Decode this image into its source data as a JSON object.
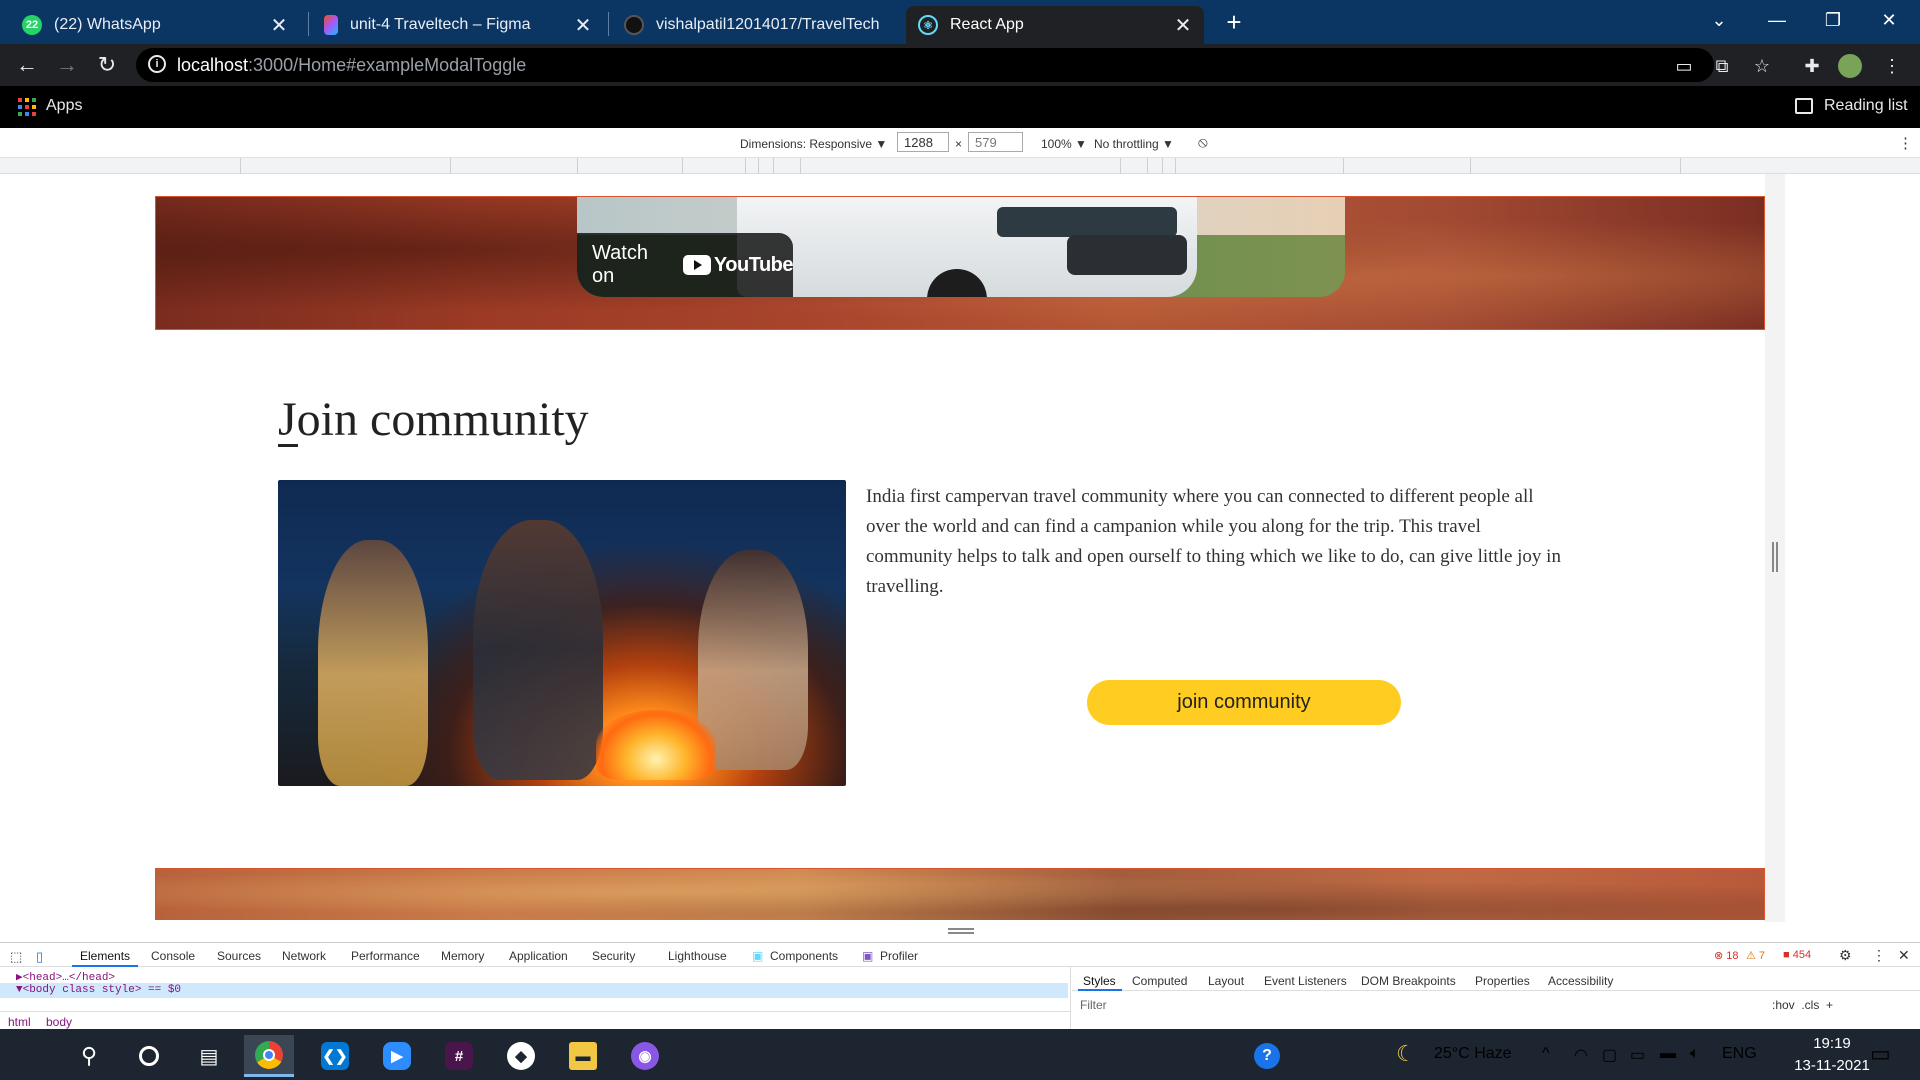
{
  "browser": {
    "tabs": [
      {
        "label": "(22) WhatsApp",
        "icon": "whatsapp-icon",
        "badge": "22"
      },
      {
        "label": "unit-4 Traveltech – Figma",
        "icon": "figma-icon"
      },
      {
        "label": "vishalpatil12014017/TravelTech",
        "icon": "github-icon"
      },
      {
        "label": "React App",
        "icon": "react-icon",
        "active": true
      }
    ],
    "close_glyph": "✕",
    "new_tab_glyph": "+",
    "url_host": "localhost",
    "url_path": ":3000/Home#exampleModalToggle",
    "bookmarks": {
      "apps": "Apps",
      "reading_list": "Reading list"
    }
  },
  "device_toolbar": {
    "dimensions": "Dimensions: Responsive ▼",
    "width": "1288",
    "times": "×",
    "height": "579",
    "zoom": "100% ▼",
    "throttling": "No throttling ▼"
  },
  "page": {
    "video": {
      "watch_on": "Watch on",
      "youtube": "YouTube"
    },
    "join": {
      "title": "Join community",
      "description": "India first campervan travel community where you can connected to different people all over the world and can find a campanion while you along for the trip. This travel community helps to talk and open ourself to thing which we like to do, can give little joy in travelling.",
      "button": "join community",
      "button_color": "#ffcc22"
    }
  },
  "devtools": {
    "tabs": [
      "Elements",
      "Console",
      "Sources",
      "Network",
      "Performance",
      "Memory",
      "Application",
      "Security",
      "Lighthouse",
      "Components",
      "Profiler"
    ],
    "errors": "18",
    "warnings": "7",
    "issues": "454",
    "code_line1": "▶<head>…</head>",
    "code_line2": "▼<body class style> == $0",
    "breadcrumbs": [
      "html",
      "body"
    ],
    "styles_tabs": [
      "Styles",
      "Computed",
      "Layout",
      "Event Listeners",
      "DOM Breakpoints",
      "Properties",
      "Accessibility"
    ],
    "filter_placeholder": "Filter",
    "filter_tools": ":hov  .cls  +"
  },
  "taskbar": {
    "weather": "25°C  Haze",
    "language": "ENG",
    "time": "19:19",
    "date": "13-11-2021"
  }
}
